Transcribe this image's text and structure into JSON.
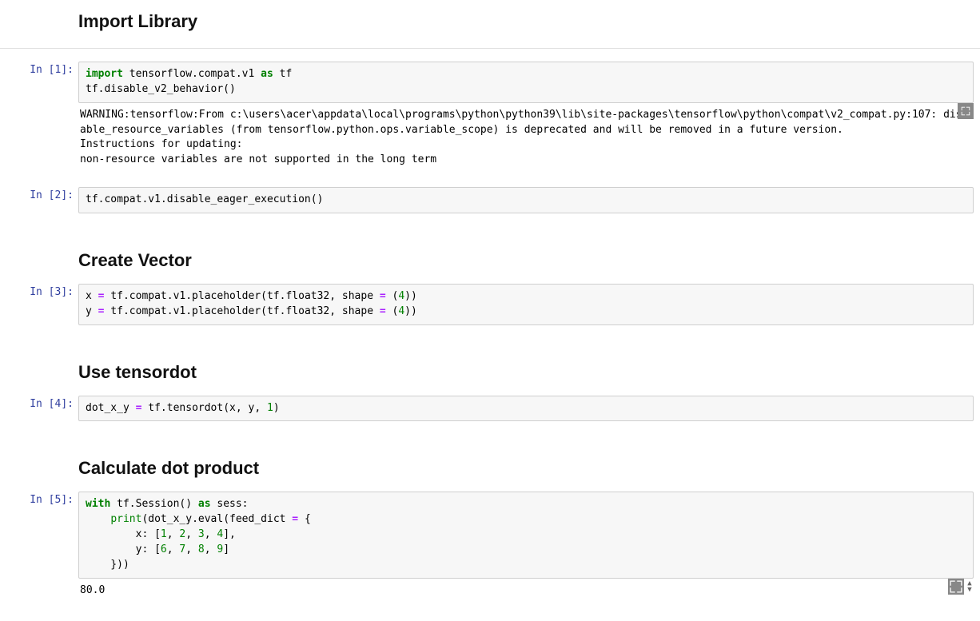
{
  "headings": {
    "import_library": "Import Library",
    "create_vector": "Create Vector",
    "use_tensordot": "Use tensordot",
    "calc_dot": "Calculate dot product"
  },
  "prompts": {
    "in1": "In [1]:",
    "in2": "In [2]:",
    "in3": "In [3]:",
    "in4": "In [4]:",
    "in5": "In [5]:"
  },
  "code": {
    "c1_kw_import": "import",
    "c1_mod": " tensorflow.compat.v1 ",
    "c1_kw_as": "as",
    "c1_alias": " tf",
    "c1_line2": "tf.disable_v2_behavior()",
    "c2_line1": "tf.compat.v1.disable_eager_execution()",
    "c3_l1a": "x ",
    "c3_l1b": " tf.compat.v1.placeholder(tf.float32, shape ",
    "c3_l1c": " (",
    "c3_l1_num": "4",
    "c3_l1d": "))",
    "c3_l2a": "y ",
    "c3_l2b": " tf.compat.v1.placeholder(tf.float32, shape ",
    "c3_l2c": " (",
    "c3_l2_num": "4",
    "c3_l2d": "))",
    "c4_a": "dot_x_y ",
    "c4_b": " tf.tensordot(x, y, ",
    "c4_num": "1",
    "c4_c": ")",
    "c5_with": "with",
    "c5_sess": " tf.Session() ",
    "c5_as": "as",
    "c5_sessv": " sess:",
    "c5_print": "print",
    "c5_eval_open": "(dot_x_y.eval(feed_dict ",
    "c5_brace": " {",
    "c5_x": "        x: [",
    "c5_n1": "1",
    "c5_c1": ", ",
    "c5_n2": "2",
    "c5_c2": ", ",
    "c5_n3": "3",
    "c5_c3": ", ",
    "c5_n4": "4",
    "c5_xend": "],",
    "c5_y": "        y: [",
    "c5_n6": "6",
    "c5_n7": "7",
    "c5_n8": "8",
    "c5_n9": "9",
    "c5_yend": "]",
    "c5_close": "    }))",
    "eq": "="
  },
  "outputs": {
    "o1": "WARNING:tensorflow:From c:\\users\\acer\\appdata\\local\\programs\\python\\python39\\lib\\site-packages\\tensorflow\\python\\compat\\v2_compat.py:107: disable_resource_variables (from tensorflow.python.ops.variable_scope) is deprecated and will be removed in a future version.\nInstructions for updating:\nnon-resource variables are not supported in the long term",
    "o5": "80.0"
  }
}
